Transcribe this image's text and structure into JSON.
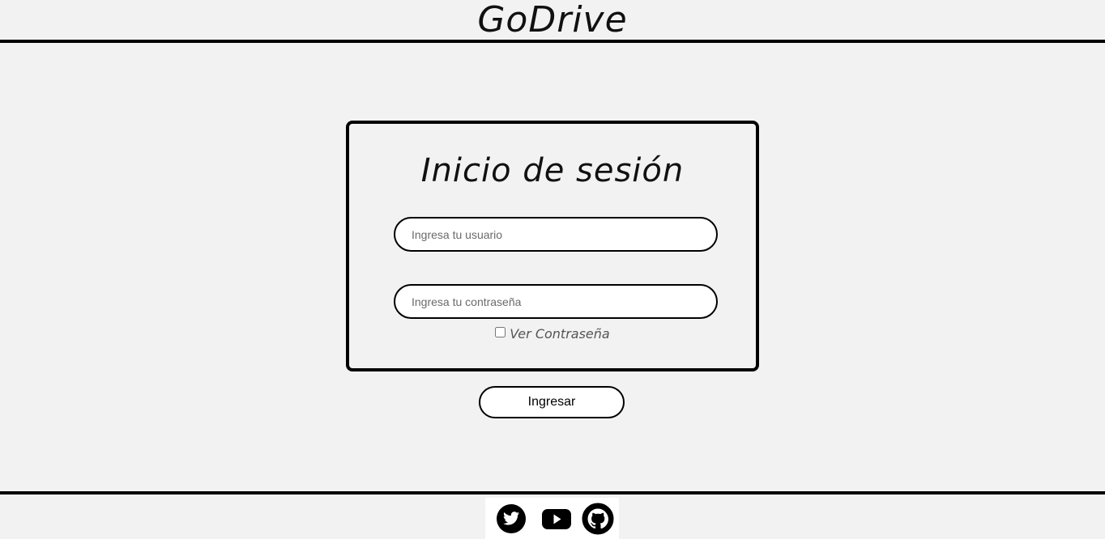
{
  "header": {
    "brand": "GoDrive"
  },
  "login": {
    "title": "Inicio de sesión",
    "username_placeholder": "Ingresa tu usuario",
    "password_placeholder": "Ingresa tu contraseña",
    "show_password_label": "Ver Contraseña",
    "show_password_checked": false,
    "submit_label": "Ingresar"
  },
  "footer": {
    "social_icons": [
      "twitter-icon",
      "youtube-icon",
      "github-icon"
    ]
  }
}
